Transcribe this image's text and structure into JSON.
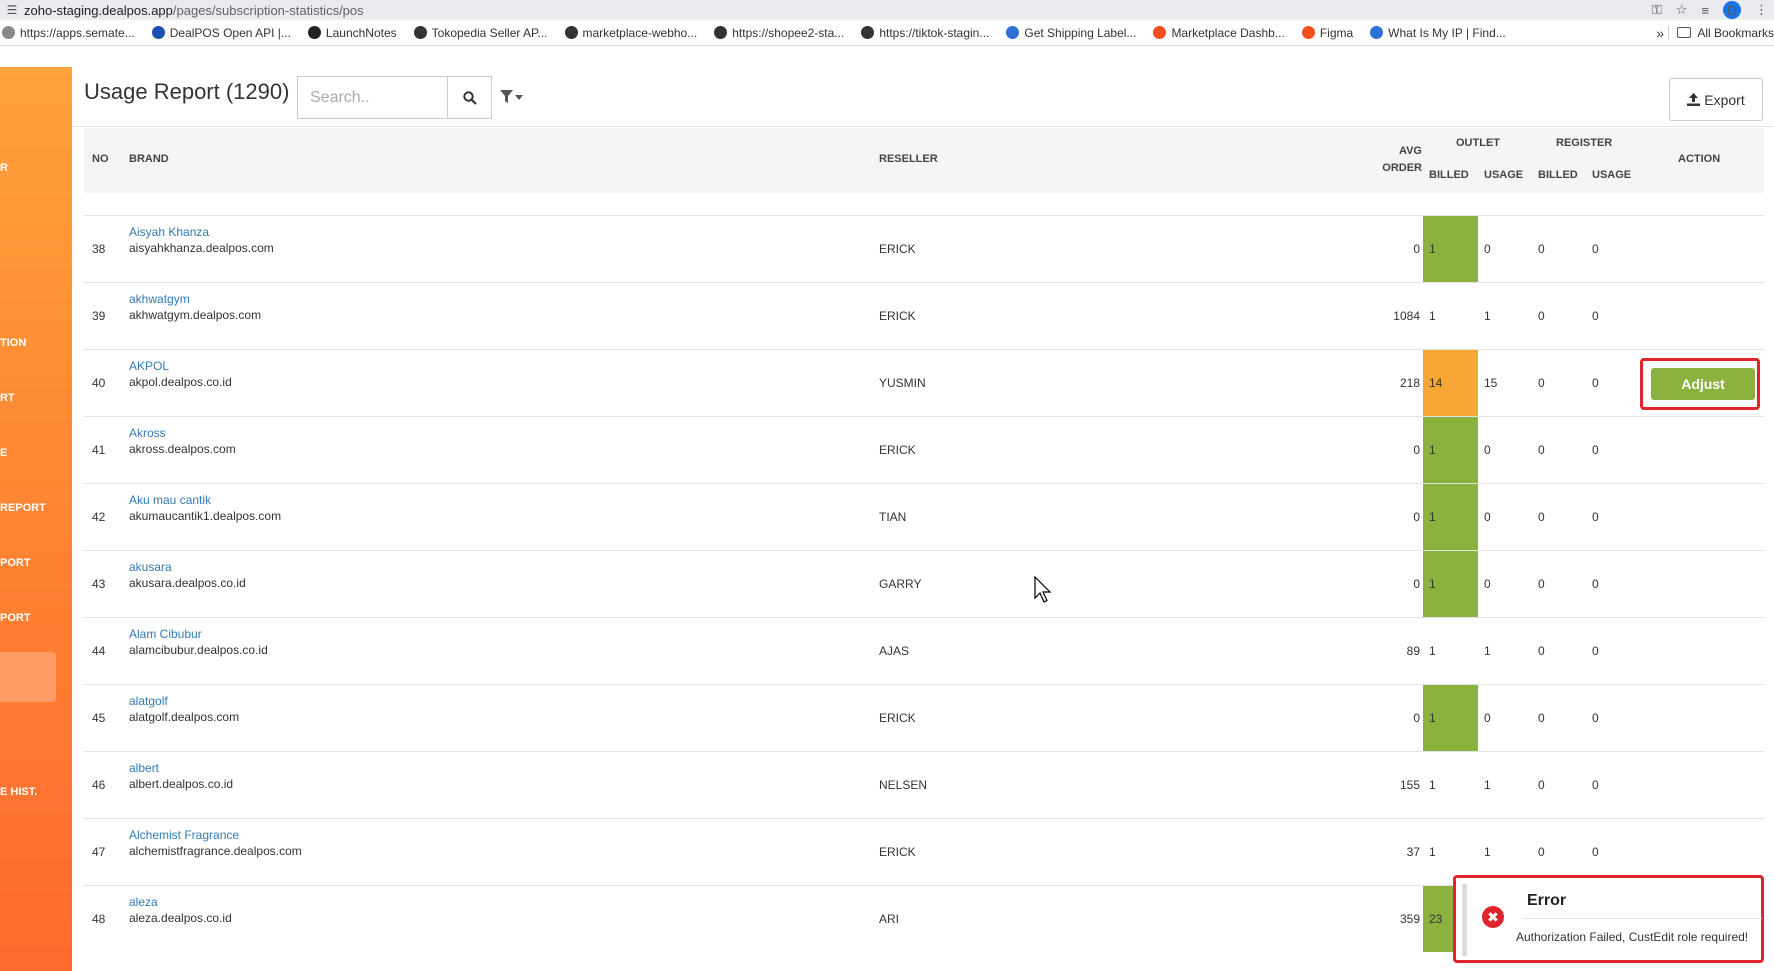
{
  "browser": {
    "url_host": "zoho-staging.dealpos.app",
    "url_path": "/pages/subscription-statistics/pos",
    "profile_initial": "D",
    "bookmarks": [
      {
        "label": "https://apps.semate...",
        "color": "#888"
      },
      {
        "label": "DealPOS Open API |...",
        "color": "#1f4fb3"
      },
      {
        "label": "LaunchNotes",
        "color": "#222"
      },
      {
        "label": "Tokopedia Seller AP...",
        "color": "#333"
      },
      {
        "label": "marketplace-webho...",
        "color": "#333"
      },
      {
        "label": "https://shopee2-sta...",
        "color": "#333"
      },
      {
        "label": "https://tiktok-stagin...",
        "color": "#333"
      },
      {
        "label": "Get Shipping Label...",
        "color": "#2f6fd6"
      },
      {
        "label": "Marketplace Dashb...",
        "color": "#f24e1e"
      },
      {
        "label": "Figma",
        "color": "#f24e1e"
      },
      {
        "label": "What Is My IP | Find...",
        "color": "#2b74d6"
      }
    ],
    "more": "»",
    "all_bookmarks": "All Bookmarks"
  },
  "sidebar": {
    "items": [
      "R",
      "TION",
      "RT",
      "E",
      "REPORT",
      "PORT",
      "PORT",
      "E HIST."
    ]
  },
  "header": {
    "title": "Usage Report (1290)",
    "search_placeholder": "Search..",
    "export_label": "Export"
  },
  "table": {
    "headers": {
      "no": "NO",
      "brand": "BRAND",
      "reseller": "RESELLER",
      "avg_order_1": "AVG",
      "avg_order_2": "ORDER",
      "outlet": "OUTLET",
      "register": "REGISTER",
      "billed": "BILLED",
      "usage": "USAGE",
      "action": "ACTION"
    },
    "rows": [
      {
        "no": "38",
        "name": "Aisyah Khanza",
        "domain": "aisyahkhanza.dealpos.com",
        "reseller": "ERICK",
        "avg": "0",
        "o_billed": "1",
        "o_usage": "0",
        "r_billed": "0",
        "r_usage": "0",
        "highlight": "green"
      },
      {
        "no": "39",
        "name": "akhwatgym",
        "domain": "akhwatgym.dealpos.com",
        "reseller": "ERICK",
        "avg": "1084",
        "o_billed": "1",
        "o_usage": "1",
        "r_billed": "0",
        "r_usage": "0",
        "highlight": "none"
      },
      {
        "no": "40",
        "name": "AKPOL",
        "domain": "akpol.dealpos.co.id",
        "reseller": "YUSMIN",
        "avg": "218",
        "o_billed": "14",
        "o_usage": "15",
        "r_billed": "0",
        "r_usage": "0",
        "highlight": "orange",
        "action": "Adjust"
      },
      {
        "no": "41",
        "name": "Akross",
        "domain": "akross.dealpos.com",
        "reseller": "ERICK",
        "avg": "0",
        "o_billed": "1",
        "o_usage": "0",
        "r_billed": "0",
        "r_usage": "0",
        "highlight": "green"
      },
      {
        "no": "42",
        "name": "Aku mau cantik",
        "domain": "akumaucantik1.dealpos.com",
        "reseller": "TIAN",
        "avg": "0",
        "o_billed": "1",
        "o_usage": "0",
        "r_billed": "0",
        "r_usage": "0",
        "highlight": "green"
      },
      {
        "no": "43",
        "name": "akusara",
        "domain": "akusara.dealpos.co.id",
        "reseller": "GARRY",
        "avg": "0",
        "o_billed": "1",
        "o_usage": "0",
        "r_billed": "0",
        "r_usage": "0",
        "highlight": "green"
      },
      {
        "no": "44",
        "name": "Alam Cibubur",
        "domain": "alamcibubur.dealpos.co.id",
        "reseller": "AJAS",
        "avg": "89",
        "o_billed": "1",
        "o_usage": "1",
        "r_billed": "0",
        "r_usage": "0",
        "highlight": "none"
      },
      {
        "no": "45",
        "name": "alatgolf",
        "domain": "alatgolf.dealpos.com",
        "reseller": "ERICK",
        "avg": "0",
        "o_billed": "1",
        "o_usage": "0",
        "r_billed": "0",
        "r_usage": "0",
        "highlight": "green"
      },
      {
        "no": "46",
        "name": "albert",
        "domain": "albert.dealpos.co.id",
        "reseller": "NELSEN",
        "avg": "155",
        "o_billed": "1",
        "o_usage": "1",
        "r_billed": "0",
        "r_usage": "0",
        "highlight": "none"
      },
      {
        "no": "47",
        "name": "Alchemist Fragrance",
        "domain": "alchemistfragrance.dealpos.com",
        "reseller": "ERICK",
        "avg": "37",
        "o_billed": "1",
        "o_usage": "1",
        "r_billed": "0",
        "r_usage": "0",
        "highlight": "none"
      },
      {
        "no": "48",
        "name": "aleza",
        "domain": "aleza.dealpos.co.id",
        "reseller": "ARI",
        "avg": "359",
        "o_billed": "23",
        "o_usage": "",
        "r_billed": "",
        "r_usage": "",
        "highlight": "green"
      }
    ]
  },
  "toast": {
    "title": "Error",
    "message": "Authorization Failed, CustEdit role required!",
    "icon": "✖"
  },
  "colors": {
    "sidebar_top": "#ffa23a",
    "sidebar_bottom": "#ff6a2e",
    "billed_green": "#8bb13f",
    "billed_orange": "#f7a534",
    "link_blue": "#337ab7",
    "highlight_red": "#e0242b"
  }
}
